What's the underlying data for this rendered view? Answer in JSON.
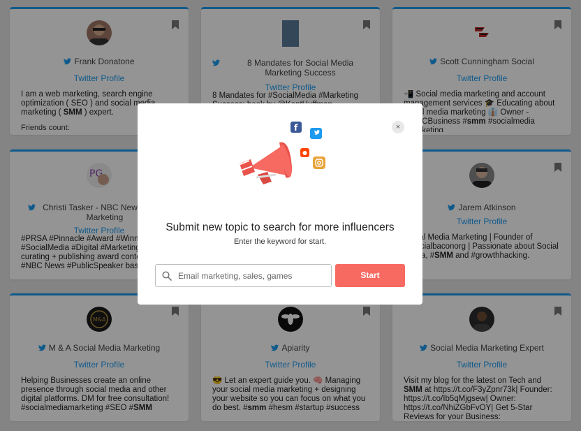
{
  "cards": [
    {
      "name": "Frank Donatone",
      "profile": "Twitter Profile",
      "bio_html": "I am a web marketing, search engine optimization ( SEO ) and social media marketing ( <b>SMM</b> ) expert.",
      "meta": "Friends count:"
    },
    {
      "name": "8 Mandates for Social Media Marketing Success",
      "profile": "Twitter Profile",
      "bio_html": "8 Mandates for #SocialMedia #Marketing Success: book by @KentHuffman",
      "meta": ""
    },
    {
      "name": "Scott Cunningham Social",
      "profile": "Twitter Profile",
      "bio_html": "📲 Social media marketing and account management services 🎓 Educating about social media marketing 👔 Owner - ScottCBusiness #<b>smm</b> #socialmedia #marketing",
      "meta": ""
    },
    {
      "name": "Christi Tasker - NBC News Media Marketing",
      "profile": "Twitter Profile",
      "bio_html": "#PRSA #Pinnacle #Award #Winner #SocialMedia #Digital #Marketing Agency curating + publishing award content | #<b>SMM</b> #NBC News #PublicSpeaker based #Miami",
      "meta": ""
    },
    {
      "name": "",
      "profile": "",
      "bio_html": "",
      "meta": ""
    },
    {
      "name": "Jarem Atkinson",
      "profile": "Twitter Profile",
      "bio_html": "Social Media Marketing | Founder of @socialbaconorg | Passionate about Social Media, #<b>SMM</b> and #growthhacking.",
      "meta": ""
    },
    {
      "name": "M & A Social Media Marketing",
      "profile": "Twitter Profile",
      "bio_html": "Helping Businesses create an online presence through social media and other digital platforms. DM for free consultation! #socialmediamarketing #SEO #<b>SMM</b>",
      "meta": ""
    },
    {
      "name": "Apiarity",
      "profile": "Twitter Profile",
      "bio_html": "😎 Let an expert guide you. 🧠 Managing your social media marketing + designing your website so you can focus on what you do best. #<b>smm</b> #hesm #startup #success",
      "meta": ""
    },
    {
      "name": "Social Media Marketing Expert",
      "profile": "Twitter Profile",
      "bio_html": "Visit my blog for the latest on Tech and <b>SMM</b> at https://t.co/F3yZpnr73k| Founder: https://t.co/Ib5qMjgsew| Owner: https://t.co/NhiZGbFvOY| Get 5-Star Reviews for your Business:",
      "meta": ""
    }
  ],
  "modal": {
    "title": "Submit new topic to search for more influencers",
    "subtitle": "Enter the keyword for start.",
    "search_placeholder": "Email marketing, sales, games",
    "start_label": "Start",
    "close_label": "×"
  },
  "icons": {
    "bookmark": "bookmark-icon",
    "twitter": "twitter-icon",
    "search": "search-icon",
    "close": "close-icon"
  },
  "colors": {
    "accent": "#1d9bf0",
    "start_button": "#f76a62",
    "megaphone": "#f76a62"
  }
}
